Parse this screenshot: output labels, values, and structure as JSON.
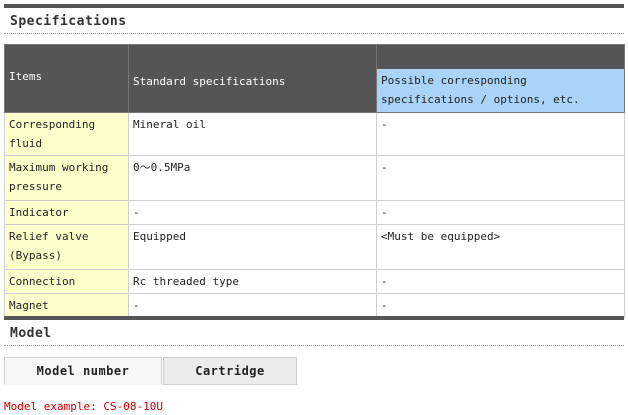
{
  "specifications": {
    "title": "Specifications",
    "headers": {
      "items": "Items",
      "standard": "Standard specifications",
      "possible": "Possible corresponding specifications / options, etc."
    },
    "rows": [
      {
        "item": "Corresponding fluid",
        "standard": "Mineral oil",
        "possible": "-"
      },
      {
        "item": "Maximum working pressure",
        "standard": "0～0.5MPa",
        "possible": "-"
      },
      {
        "item": "Indicator",
        "standard": "-",
        "possible": "-"
      },
      {
        "item": "Relief valve (Bypass)",
        "standard": "Equipped",
        "possible": "<Must be equipped>"
      },
      {
        "item": "Connection",
        "standard": "Rc threaded type",
        "possible": "-"
      },
      {
        "item": "Magnet",
        "standard": "-",
        "possible": "-"
      }
    ]
  },
  "model": {
    "title": "Model",
    "tabs": [
      {
        "label": "Model number",
        "active": true
      },
      {
        "label": "Cartridge",
        "active": false
      }
    ],
    "example": "Model example: CS-08-10U"
  },
  "colors": {
    "header_bg": "#555555",
    "item_bg": "#ffffcc",
    "possible_header_bg": "#aad4f7",
    "example_text": "#cc0000"
  }
}
